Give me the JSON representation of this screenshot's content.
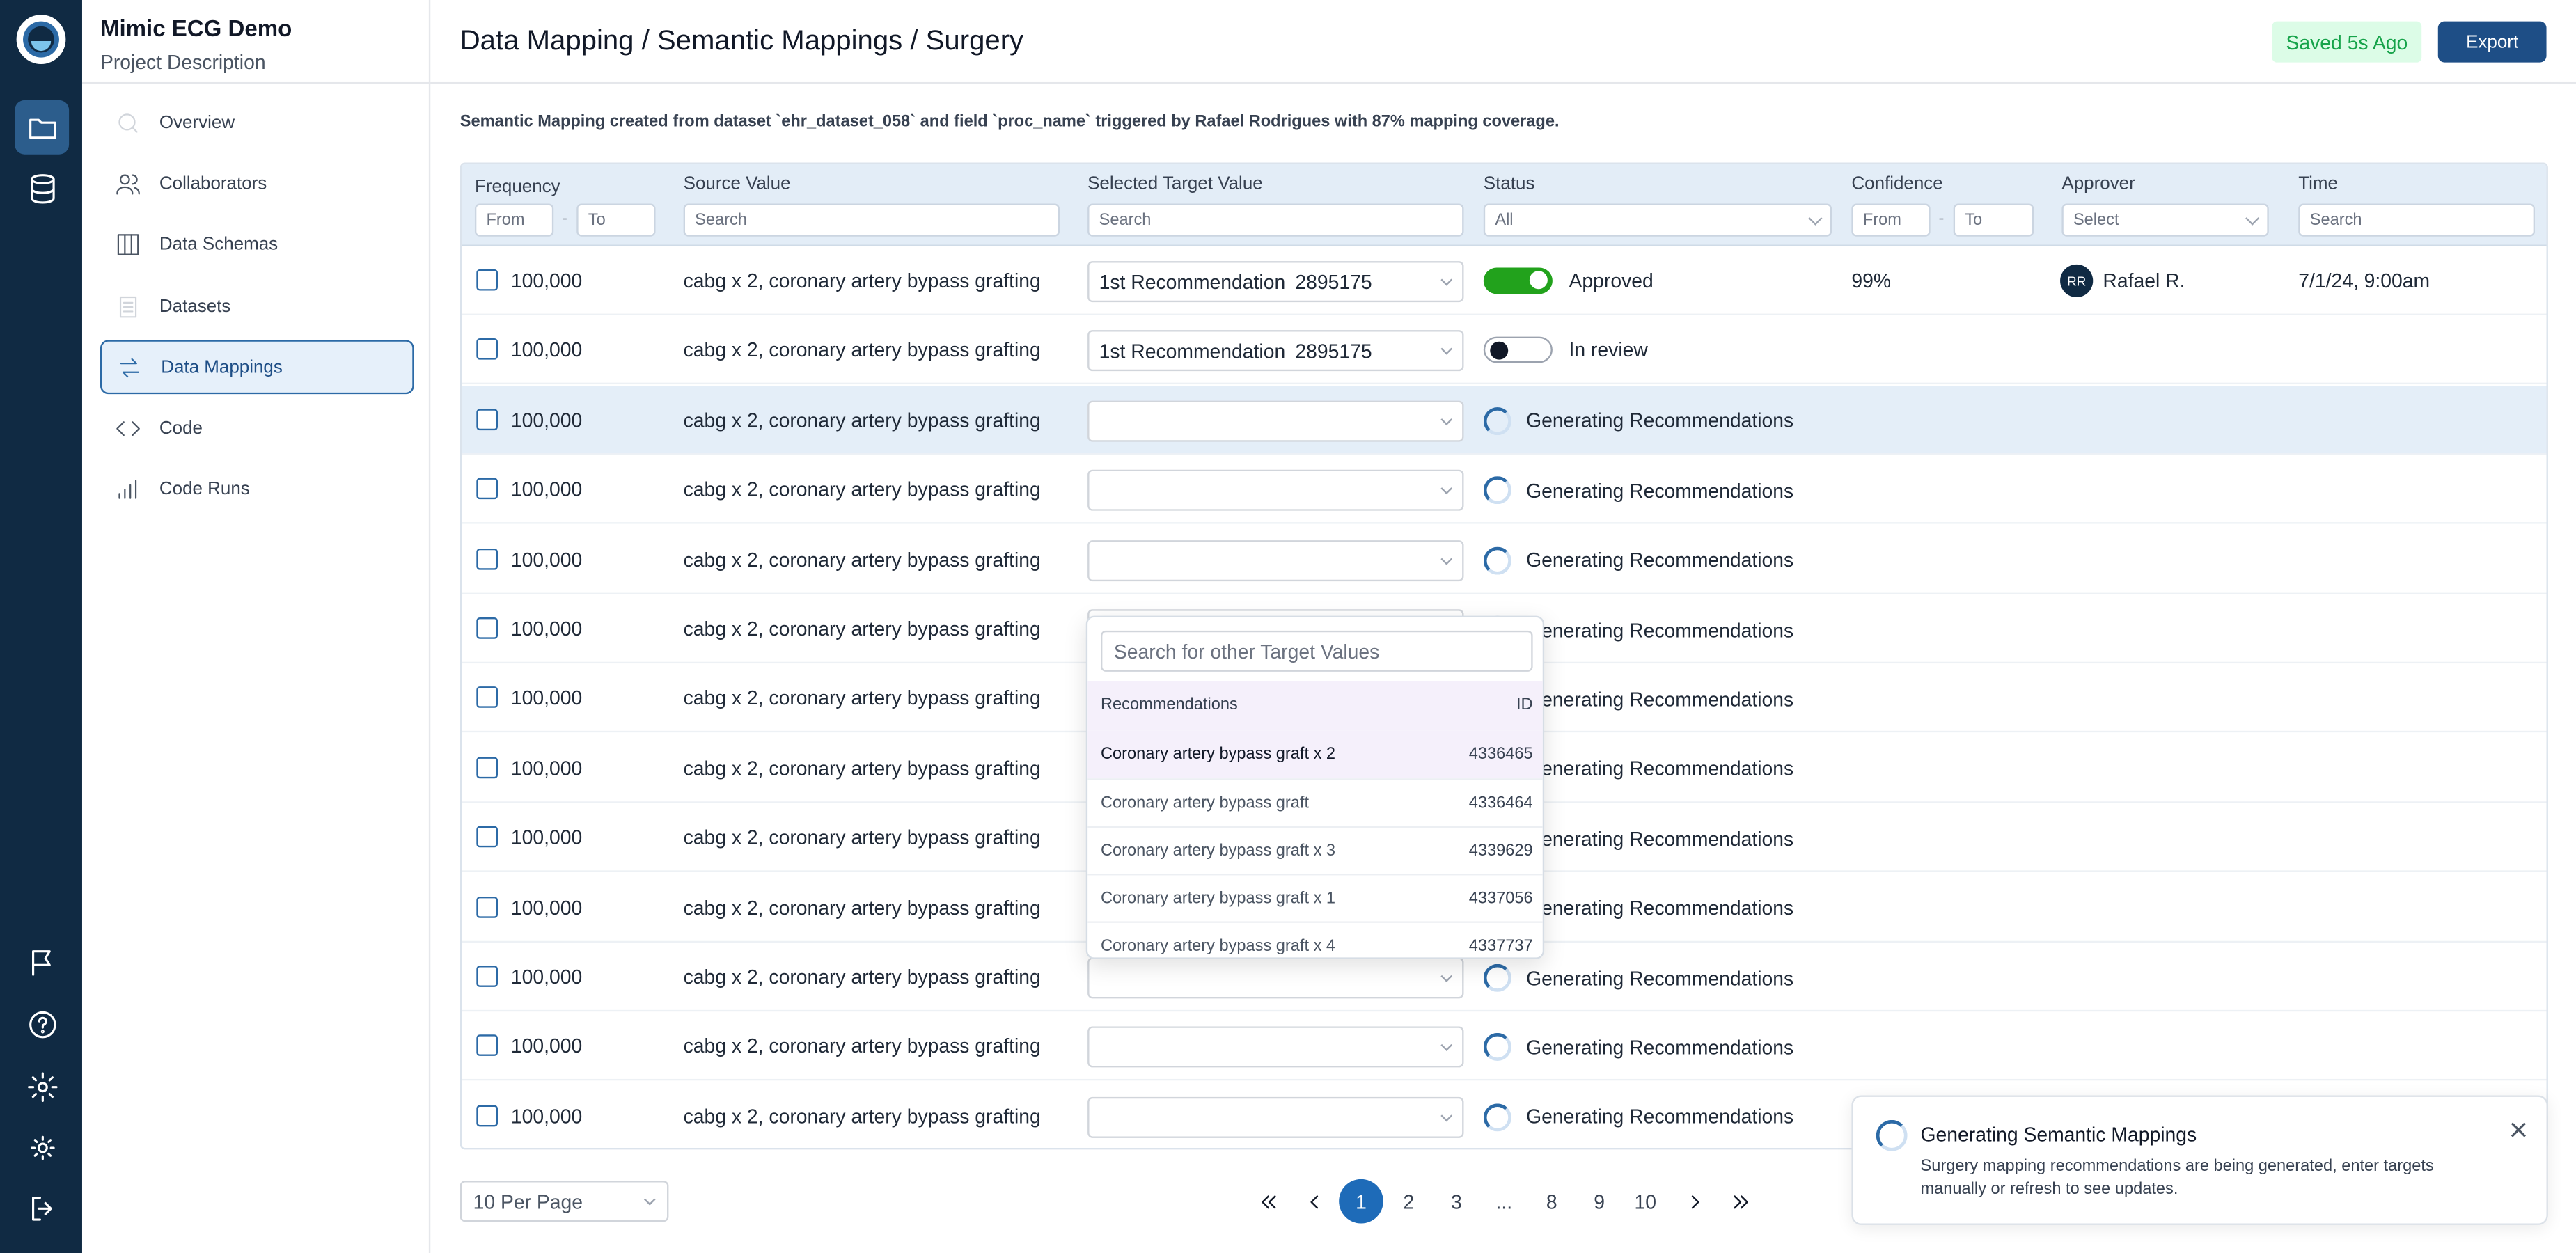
{
  "project": {
    "title": "Mimic ECG Demo",
    "description": "Project Description"
  },
  "sidebar": {
    "items": [
      {
        "label": "Overview"
      },
      {
        "label": "Collaborators"
      },
      {
        "label": "Data Schemas"
      },
      {
        "label": "Datasets"
      },
      {
        "label": "Data Mappings"
      },
      {
        "label": "Code"
      },
      {
        "label": "Code Runs"
      }
    ]
  },
  "header": {
    "breadcrumb": "Data Mapping / Semantic Mappings / Surgery",
    "saved": "Saved 5s Ago",
    "export": "Export"
  },
  "summary": "Semantic Mapping created from dataset `ehr_dataset_058` and field `proc_name` triggered by Rafael Rodrigues with 87% mapping coverage.",
  "table": {
    "columns": {
      "frequency": "Frequency",
      "source": "Source Value",
      "target": "Selected Target Value",
      "status": "Status",
      "confidence": "Confidence",
      "approver": "Approver",
      "time": "Time"
    },
    "filters": {
      "freq_from": "From",
      "freq_to": "To",
      "source": "Search",
      "target": "Search",
      "status": "All",
      "conf_from": "From",
      "conf_to": "To",
      "approver": "Select",
      "time": "Search",
      "range_sep": "-"
    },
    "rows": [
      {
        "freq": "100,000",
        "source": "cabg x 2, coronary artery bypass grafting",
        "target_label": "1st Recommendation",
        "target_id": "2895175",
        "status": "Approved",
        "confidence": "99%",
        "approver_initials": "RR",
        "approver": "Rafael R.",
        "time": "7/1/24, 9:00am"
      },
      {
        "freq": "100,000",
        "source": "cabg x 2, coronary artery bypass grafting",
        "target_label": "1st Recommendation",
        "target_id": "2895175",
        "status": "In review",
        "confidence": "",
        "approver_initials": "",
        "approver": "",
        "time": ""
      },
      {
        "freq": "100,000",
        "source": "cabg x 2, coronary artery bypass grafting",
        "status": "Generating Recommendations"
      },
      {
        "freq": "100,000",
        "source": "cabg x 2, coronary artery bypass grafting",
        "status": "Generating Recommendations"
      },
      {
        "freq": "100,000",
        "source": "cabg x 2, coronary artery bypass grafting",
        "status": "Generating Recommendations"
      },
      {
        "freq": "100,000",
        "source": "cabg x 2, coronary artery bypass grafting",
        "status": "Generating Recommendations"
      },
      {
        "freq": "100,000",
        "source": "cabg x 2, coronary artery bypass grafting",
        "status": "Generating Recommendations"
      },
      {
        "freq": "100,000",
        "source": "cabg x 2, coronary artery bypass grafting",
        "status": "Generating Recommendations"
      },
      {
        "freq": "100,000",
        "source": "cabg x 2, coronary artery bypass grafting",
        "status": "Generating Recommendations"
      },
      {
        "freq": "100,000",
        "source": "cabg x 2, coronary artery bypass grafting",
        "status": "Generating Recommendations"
      },
      {
        "freq": "100,000",
        "source": "cabg x 2, coronary artery bypass grafting",
        "status": "Generating Recommendations"
      },
      {
        "freq": "100,000",
        "source": "cabg x 2, coronary artery bypass grafting",
        "status": "Generating Recommendations"
      },
      {
        "freq": "100,000",
        "source": "cabg x 2, coronary artery bypass grafting",
        "status": "Generating Recommendations"
      }
    ]
  },
  "dropdown": {
    "placeholder": "Search for other Target Values",
    "header_name": "Recommendations",
    "header_id": "ID",
    "items": [
      {
        "name": "Coronary artery bypass graft x 2",
        "id": "4336465"
      },
      {
        "name": "Coronary artery bypass graft",
        "id": "4336464"
      },
      {
        "name": "Coronary artery bypass graft x 3",
        "id": "4339629"
      },
      {
        "name": "Coronary artery bypass graft x 1",
        "id": "4337056"
      },
      {
        "name": "Coronary artery bypass graft x 4",
        "id": "4337737"
      }
    ]
  },
  "pagination": {
    "per_page": "10 Per Page",
    "pages": [
      "1",
      "2",
      "3",
      "...",
      "8",
      "9",
      "10"
    ],
    "current": "1"
  },
  "toast": {
    "title": "Generating Semantic Mappings",
    "message": "Surgery mapping recommendations are being generated, enter targets manually or refresh to see updates."
  },
  "colors": {
    "navy": "#102a43",
    "accent": "#1e4e86",
    "approved_green": "#22a21c",
    "saved_bg": "#dcfce7",
    "saved_text": "#16a34a"
  }
}
